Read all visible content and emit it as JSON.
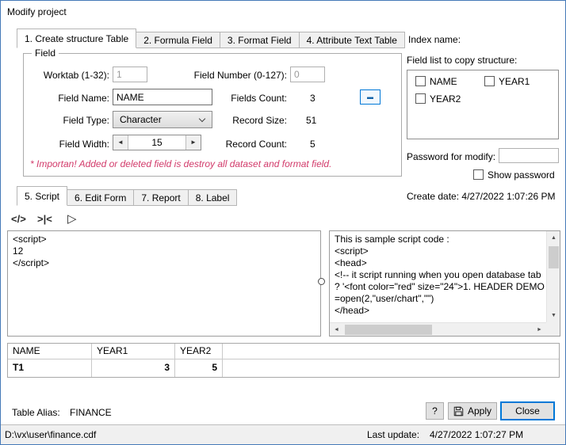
{
  "window": {
    "title": "Modify project"
  },
  "tabs_top": [
    {
      "label": "1. Create structure Table"
    },
    {
      "label": "2. Formula Field"
    },
    {
      "label": "3. Format Field"
    },
    {
      "label": "4. Attribute Text Table"
    }
  ],
  "field_group": {
    "legend": "Field",
    "worktab": {
      "label": "Worktab (1-32):",
      "value": "1"
    },
    "field_number": {
      "label": "Field Number (0-127):",
      "value": "0"
    },
    "field_name": {
      "label": "Field Name:",
      "value": "NAME"
    },
    "fields_count": {
      "label": "Fields Count:",
      "value": "3"
    },
    "field_type": {
      "label": "Field Type:",
      "value": "Character"
    },
    "record_size": {
      "label": "Record Size:",
      "value": "51"
    },
    "field_width": {
      "label": "Field Width:",
      "value": "15"
    },
    "record_count": {
      "label": "Record Count:",
      "value": "5"
    },
    "remove_glyph": "▬",
    "spin_left": "◄",
    "spin_right": "►",
    "warning": "* Importan! Added or deleted field is destroy all dataset and format field."
  },
  "right_panel": {
    "index_name_label": "Index name:",
    "field_list_label": "Field list to copy structure:",
    "field_list": [
      {
        "label": "NAME"
      },
      {
        "label": "YEAR1"
      },
      {
        "label": "YEAR2"
      }
    ],
    "password_label": "Password for modify:",
    "show_password_label": "Show password",
    "create_date_label": "Create date:",
    "create_date_value": "4/27/2022 1:07:26 PM"
  },
  "tabs_script": [
    {
      "label": "5. Script"
    },
    {
      "label": "6. Edit Form"
    },
    {
      "label": "7. Report"
    },
    {
      "label": "8. Label"
    }
  ],
  "script_section": {
    "icon_code": "</>",
    "icon_collapse": ">|<",
    "icon_run": "▷",
    "code_text": "<script>\n12\n</script>",
    "sample_text": "This is sample script code :\n<script>\n<head>\n<!-- it script running when you open database tab\n? '<font color=\"red\" size=\"24\">1. HEADER DEMO\n=open(2,\"user/chart\",\"\")\n</head>",
    "scroll_up": "▲",
    "scroll_down": "▼",
    "scroll_left": "◄",
    "scroll_right": "►"
  },
  "data_table": {
    "headers": [
      "NAME",
      "YEAR1",
      "YEAR2"
    ],
    "row": {
      "name": "T1",
      "year1": "3",
      "year2": "5"
    }
  },
  "footer": {
    "table_alias_label": "Table Alias:",
    "table_alias_value": "FINANCE",
    "help_label": "?",
    "apply_label": "Apply",
    "close_label": "Close"
  },
  "status_bar": {
    "file_path": "D:\\vx\\user\\finance.cdf",
    "last_update_label": "Last update:",
    "last_update_value": "4/27/2022 1:07:27 PM"
  }
}
